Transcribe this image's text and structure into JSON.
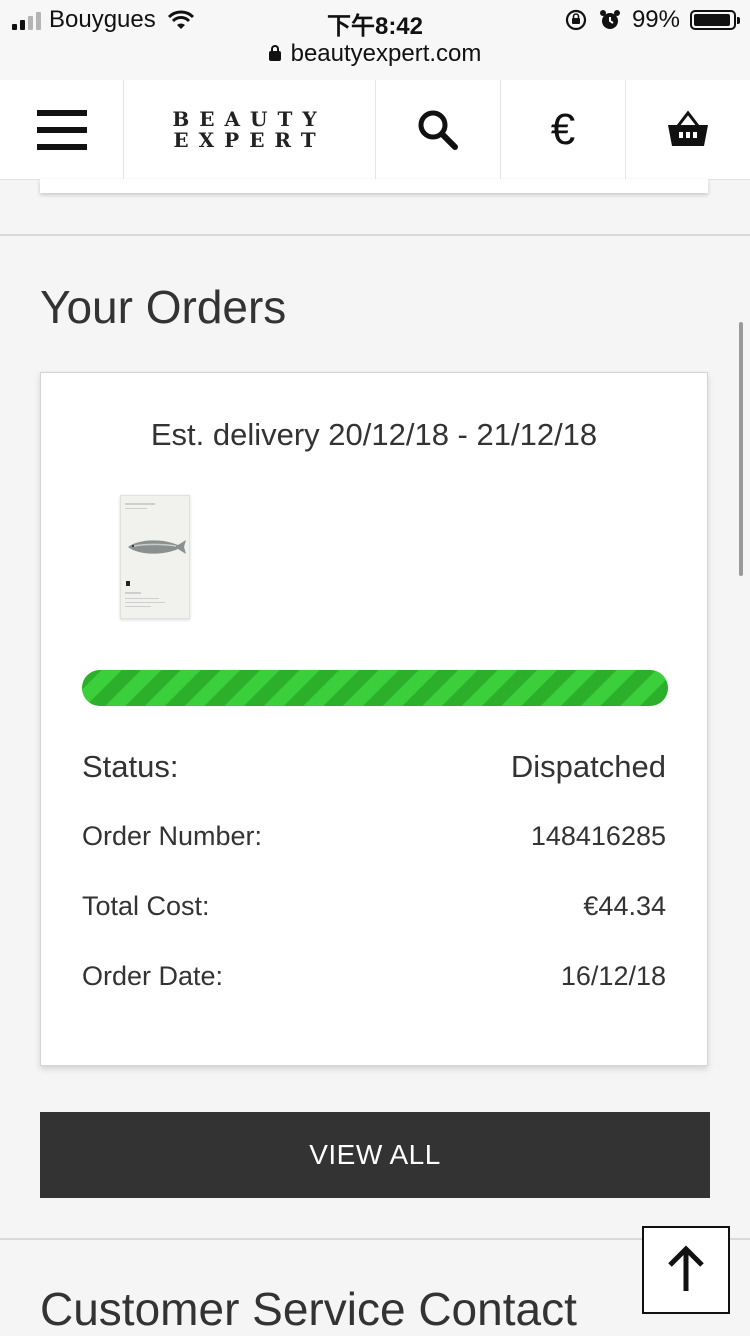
{
  "status_bar": {
    "carrier": "Bouygues",
    "time": "下午8:42",
    "battery": "99%",
    "url": "beautyexpert.com",
    "icons": [
      "signal-icon",
      "wifi-icon",
      "rotation-lock-icon",
      "alarm-icon",
      "battery-icon",
      "lock-icon"
    ]
  },
  "header": {
    "logo_line1": "BEAUTY",
    "logo_line2": "EXPERT",
    "currency_symbol": "€",
    "icons": [
      "menu-icon",
      "search-icon",
      "basket-icon"
    ]
  },
  "orders": {
    "title": "Your Orders",
    "delivery": "Est. delivery 20/12/18 - 21/12/18",
    "progress_fraction": 1.0,
    "status_label": "Status:",
    "status_value": "Dispatched",
    "order_number_label": "Order Number:",
    "order_number": "148416285",
    "total_cost_label": "Total Cost:",
    "total_cost": "€44.34",
    "order_date_label": "Order Date:",
    "order_date": "16/12/18",
    "view_all_label": "VIEW ALL"
  },
  "customer_service": {
    "title": "Customer Service Contact"
  },
  "colors": {
    "progress_green": "#2fbf2f",
    "button_dark": "#333333"
  }
}
